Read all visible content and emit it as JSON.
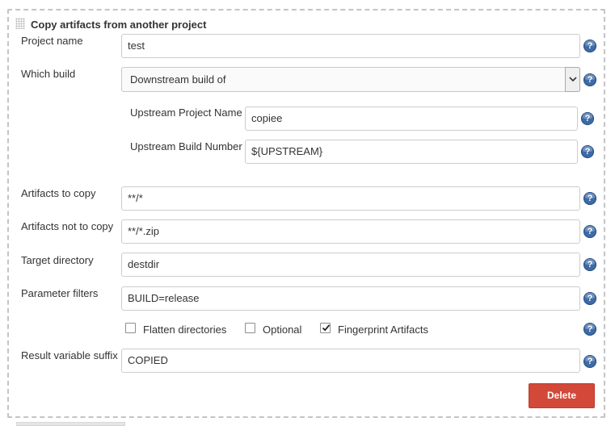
{
  "section": {
    "title": "Copy artifacts from another project"
  },
  "fields": {
    "project_name": {
      "label": "Project name",
      "value": "test"
    },
    "which_build": {
      "label": "Which build",
      "value": "Downstream build of"
    },
    "upstream_project_name": {
      "label": "Upstream Project Name",
      "value": "copiee"
    },
    "upstream_build_number": {
      "label": "Upstream Build Number",
      "value": "${UPSTREAM}"
    },
    "artifacts_to_copy": {
      "label": "Artifacts to copy",
      "value": "**/*"
    },
    "artifacts_not_to_copy": {
      "label": "Artifacts not to copy",
      "value": "**/*.zip"
    },
    "target_directory": {
      "label": "Target directory",
      "value": "destdir"
    },
    "parameter_filters": {
      "label": "Parameter filters",
      "value": "BUILD=release"
    },
    "result_variable_suffix": {
      "label": "Result variable suffix",
      "value": "COPIED"
    }
  },
  "options": {
    "flatten_directories": {
      "label": "Flatten directories",
      "checked": false
    },
    "optional": {
      "label": "Optional",
      "checked": false
    },
    "fingerprint_artifacts": {
      "label": "Fingerprint Artifacts",
      "checked": true
    }
  },
  "help_glyph": "?",
  "actions": {
    "delete_label": "Delete"
  },
  "colors": {
    "delete": "#d24939",
    "help": "#3e6aa6"
  }
}
